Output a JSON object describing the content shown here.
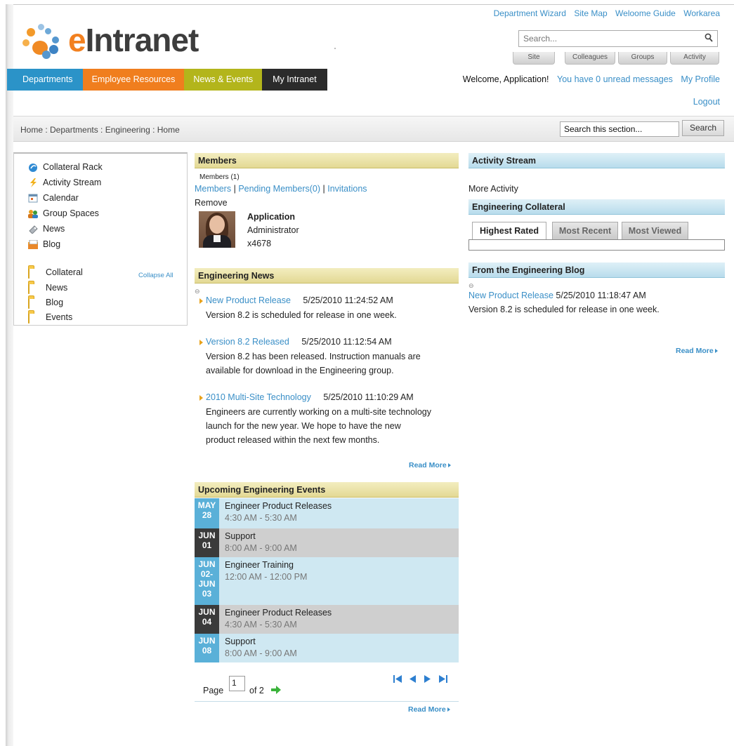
{
  "brand": {
    "name": "eIntranet"
  },
  "toplinks": [
    "Department Wizard",
    "Site Map",
    "Weloome Guide",
    "Workarea"
  ],
  "search": {
    "placeholder": "Search..."
  },
  "scope_tabs": [
    "Site",
    "Colleagues",
    "Groups",
    "Activity"
  ],
  "nav": [
    {
      "label": "Departments",
      "color": "#2b93c8"
    },
    {
      "label": "Employee Resources",
      "color": "#f07e1e"
    },
    {
      "label": "News & Events",
      "color": "#b3b51b"
    },
    {
      "label": "My Intranet",
      "color": "#2b2b2b"
    }
  ],
  "welcome": {
    "text": "Welcome, Application!",
    "messages": "You have 0 unread messages",
    "profile": "My Profile",
    "logout": "Logout"
  },
  "breadcrumb": "Home : Departments : Engineering : Home",
  "section_search": {
    "value": "Search this section...",
    "button": "Search"
  },
  "left_panel": {
    "links": [
      {
        "label": "Collateral Rack",
        "icon": "collateral-rack-icon"
      },
      {
        "label": "Activity Stream",
        "icon": "lightning-icon"
      },
      {
        "label": "Calendar",
        "icon": "calendar-icon"
      },
      {
        "label": "Group Spaces",
        "icon": "group-spaces-icon"
      },
      {
        "label": "News",
        "icon": "news-icon"
      },
      {
        "label": "Blog",
        "icon": "blog-icon"
      }
    ],
    "folders": [
      "Collateral",
      "News",
      "Blog",
      "Events"
    ],
    "collapse_all": "Collapse All"
  },
  "members": {
    "header": "Members",
    "count": "Members (1)",
    "links": {
      "members": "Members",
      "pending": "Pending Members(0)",
      "invitations": "Invitations",
      "remove": "Remove",
      "sep": "|"
    },
    "user": {
      "name": "Application",
      "role": "Administrator",
      "ext": "x4678"
    }
  },
  "engineering_news": {
    "header": "Engineering News",
    "items": [
      {
        "title": "New Product Release",
        "date": "5/25/2010 11:24:52 AM",
        "body": "Version 8.2 is scheduled for release in one week."
      },
      {
        "title": "Version 8.2 Released",
        "date": "5/25/2010 11:12:54 AM",
        "body_lines": [
          "Version 8.2 has been released. Instruction manuals are",
          "available for download in the Engineering group."
        ]
      },
      {
        "title": "2010 Multi-Site Technology",
        "date": "5/25/2010 11:10:29 AM",
        "body_lines": [
          "Engineers are currently working on a multi-site technology",
          "launch for the new year. We hope to have the new",
          "product released within the next few months."
        ]
      }
    ],
    "read_more": "Read More"
  },
  "events": {
    "header": "Upcoming Engineering Events",
    "items": [
      {
        "date_lines": [
          "MAY",
          "28"
        ],
        "title": "Engineer Product Releases",
        "time": "4:30 AM - 5:30 AM",
        "date_color": "#5ab0d8",
        "bg": "#cfe8f2"
      },
      {
        "date_lines": [
          "JUN",
          "01"
        ],
        "title": "Support",
        "time": "8:00 AM - 9:00 AM",
        "date_color": "#3a3a3a",
        "bg": "#cfcfcf"
      },
      {
        "date_lines": [
          "JUN",
          "02-",
          "JUN",
          "03"
        ],
        "title": "Engineer Training",
        "time": "12:00 AM - 12:00 PM",
        "date_color": "#5ab0d8",
        "bg": "#cfe8f2"
      },
      {
        "date_lines": [
          "JUN",
          "04"
        ],
        "title": "Engineer Product Releases",
        "time": "4:30 AM - 5:30 AM",
        "date_color": "#3a3a3a",
        "bg": "#cfcfcf"
      },
      {
        "date_lines": [
          "JUN",
          "08"
        ],
        "title": "Support",
        "time": "8:00 AM - 9:00 AM",
        "date_color": "#5ab0d8",
        "bg": "#cfe8f2"
      }
    ],
    "pager": {
      "page_label": "Page",
      "page": "1",
      "of": "of 2"
    },
    "read_more": "Read More"
  },
  "activity_stream": {
    "header": "Activity Stream",
    "more": "More Activity"
  },
  "collateral": {
    "header": "Engineering Collateral",
    "tabs": [
      "Highest Rated",
      "Most Recent",
      "Most Viewed"
    ]
  },
  "blog": {
    "header": "From the Engineering Blog",
    "title": "New Product Release",
    "date": "5/25/2010 11:18:47 AM",
    "body": "Version 8.2 is scheduled for release in one week.",
    "read_more": "Read More"
  }
}
